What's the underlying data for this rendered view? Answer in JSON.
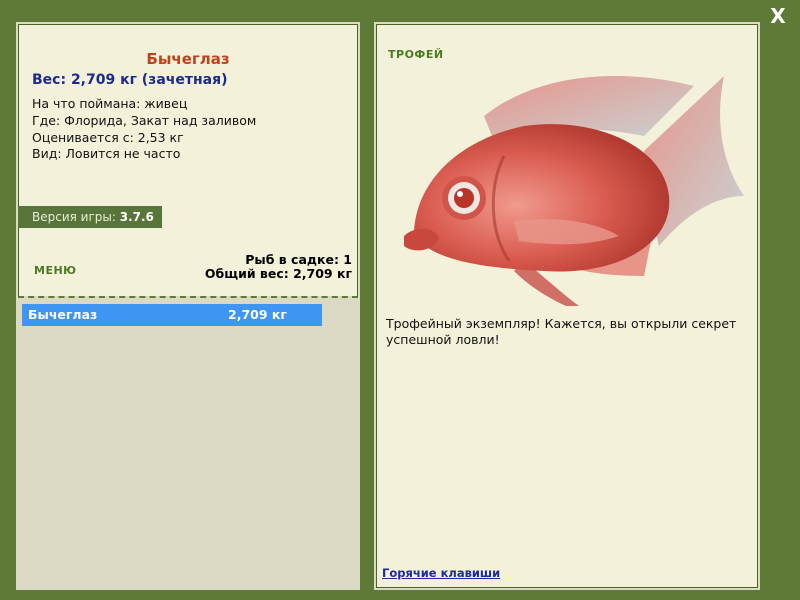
{
  "close_label": "X",
  "fish": {
    "name": "Бычеглаз",
    "weight_line": "Вес: 2,709 кг (зачетная)",
    "bait": "На что поймана: живец",
    "location": "Где: Флорида, Закат над заливом",
    "value": "Оценивается с: 2,53 кг",
    "rarity": "Вид: Ловится не часто"
  },
  "version": {
    "label": "Версия игры:",
    "number": "3.7.6"
  },
  "menu_label": "МЕНЮ",
  "net": {
    "count": "Рыб в садке: 1",
    "total": "Общий вес: 2,709 кг"
  },
  "list": [
    {
      "name": "Бычеглаз",
      "weight": "2,709 кг"
    }
  ],
  "trophy": {
    "label": "ТРОФЕЙ",
    "message": "Трофейный экземпляр! Кажется, вы открыли секрет успешной ловли!"
  },
  "hotkeys_label": "Горячие клавиши",
  "colors": {
    "frame": "#5e7a36",
    "panel": "#f4f1db",
    "accent_green": "#4b7a22",
    "selected_row": "#3f96f2"
  }
}
